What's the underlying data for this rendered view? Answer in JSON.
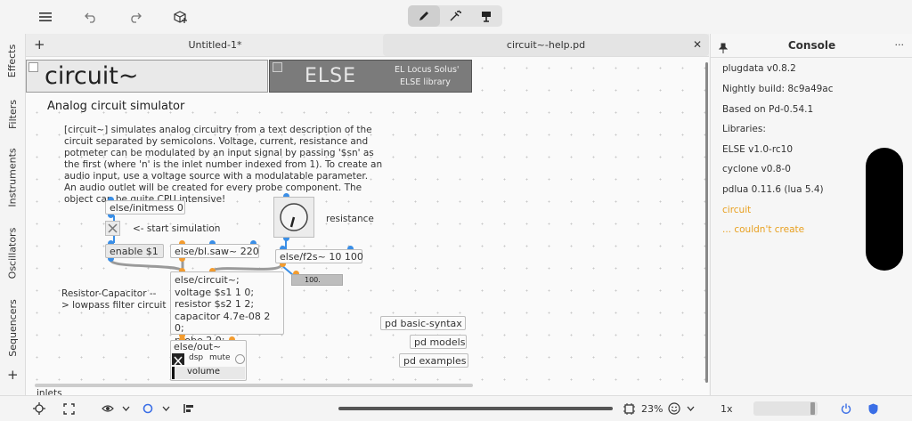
{
  "toolbar": {
    "icons": [
      "menu-icon",
      "undo-icon",
      "redo-icon",
      "add-object-icon",
      "edit-mode-icon",
      "run-mode-icon",
      "presentation-mode-icon"
    ]
  },
  "sidebar": {
    "tabs": [
      "Effects",
      "Filters",
      "Instruments",
      "Oscillators",
      "Sequencers"
    ],
    "add": "+"
  },
  "tabs": {
    "add": "+",
    "items": [
      {
        "label": "Untitled-1*"
      },
      {
        "label": "circuit~-help.pd"
      }
    ],
    "close": "✕"
  },
  "patch": {
    "header_title": "circuit~",
    "else_label": "ELSE",
    "else_sub1": "EL Locus Solus'",
    "else_sub2": "ELSE library",
    "subtitle": "Analog circuit simulator",
    "description": "[circuit~] simulates analog circuitry from a text description of the circuit separated by semicolons. Voltage, current, resistance and potmeter can be modulated by an input signal by passing '$sn' as the first (where 'n' is the inlet number indexed from 1). To create an audio input, use a voltage source with a modulatable parameter. An audio outlet will be created for every probe component. The object can be quite CPU intensive!",
    "initmess": "else/initmess 0",
    "start_sim": "<- start simulation",
    "enable": "enable $1",
    "blsaw": "else/bl.saw~ 220",
    "resistance": "resistance",
    "f2s": "else/f2s~ 10 100",
    "number": "100.",
    "circuit_lines": [
      "else/circuit~;",
      "voltage $s1 1 0;",
      "resistor $s2 1 2;",
      "capacitor 4.7e-08 2 0;",
      "probe 2 0;"
    ],
    "rc_comment_1": "Resistor-Capacitor --",
    "rc_comment_2": "> lowpass filter circuit",
    "out": "else/out~",
    "dsp": "dsp",
    "mute": "mute",
    "volume": "volume",
    "basic_syntax": "pd basic-syntax",
    "models": "pd models",
    "examples": "pd examples",
    "inlets": "inlets"
  },
  "console": {
    "title": "Console",
    "more": "···",
    "lines": [
      {
        "text": "plugdata v0.8.2",
        "color": "#333333"
      },
      {
        "text": "Nightly build: 8c9a49ac",
        "color": "#333333"
      },
      {
        "text": "Based on Pd-0.54.1",
        "color": "#333333"
      },
      {
        "text": "Libraries:",
        "color": "#333333"
      },
      {
        "text": "ELSE v1.0-rc10",
        "color": "#333333"
      },
      {
        "text": "cyclone v0.8-0",
        "color": "#333333"
      },
      {
        "text": "pdlua 0.11.6 (lua 5.4)",
        "color": "#333333"
      },
      {
        "text": "circuit",
        "color": "#e8a020"
      },
      {
        "text": "... couldn't create",
        "color": "#e8a020"
      }
    ]
  },
  "statusbar": {
    "zoom": "23%",
    "speed": "1x"
  }
}
